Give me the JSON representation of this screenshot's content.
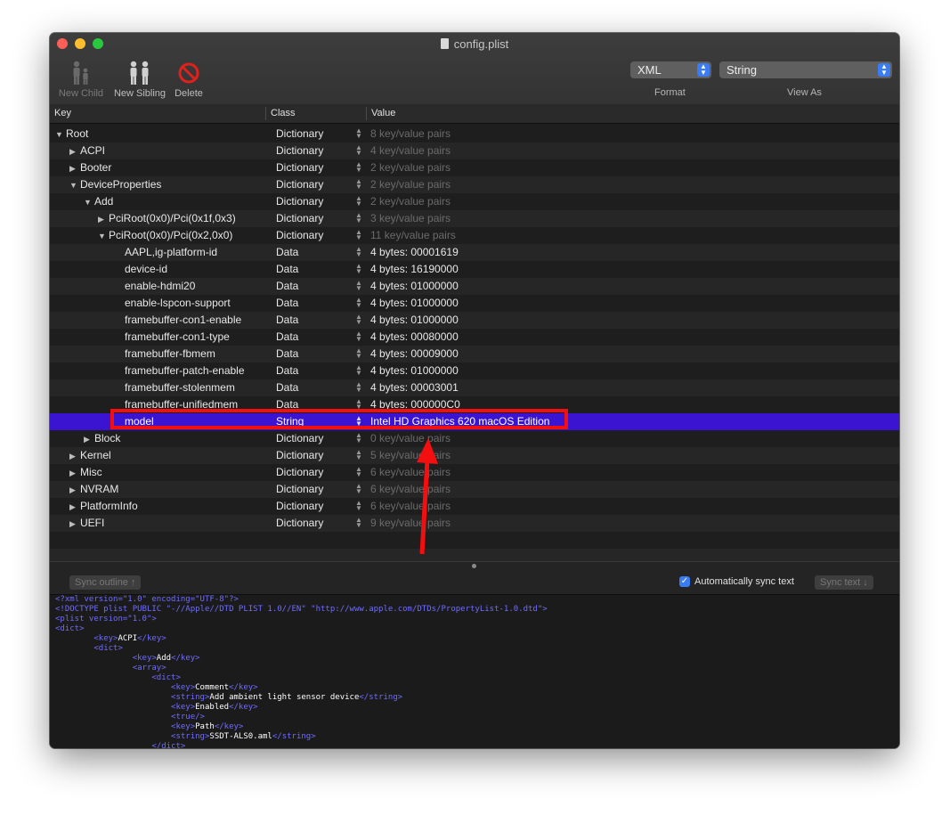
{
  "window": {
    "title": "config.plist"
  },
  "toolbar": {
    "new_child": "New Child",
    "new_sibling": "New Sibling",
    "delete": "Delete",
    "format_value": "XML",
    "format_label": "Format",
    "viewas_value": "String",
    "viewas_label": "View As"
  },
  "columns": {
    "key": "Key",
    "class": "Class",
    "value": "Value"
  },
  "rows": [
    {
      "key": "Root",
      "class": "Dictionary",
      "value": "8 key/value pairs",
      "expander": "open"
    },
    {
      "key": "ACPI",
      "class": "Dictionary",
      "value": "4 key/value pairs",
      "expander": "closed"
    },
    {
      "key": "Booter",
      "class": "Dictionary",
      "value": "2 key/value pairs",
      "expander": "closed"
    },
    {
      "key": "DeviceProperties",
      "class": "Dictionary",
      "value": "2 key/value pairs",
      "expander": "open"
    },
    {
      "key": "Add",
      "class": "Dictionary",
      "value": "2 key/value pairs",
      "expander": "open"
    },
    {
      "key": "PciRoot(0x0)/Pci(0x1f,0x3)",
      "class": "Dictionary",
      "value": "3 key/value pairs",
      "expander": "closed"
    },
    {
      "key": "PciRoot(0x0)/Pci(0x2,0x0)",
      "class": "Dictionary",
      "value": "11 key/value pairs",
      "expander": "open"
    },
    {
      "key": "AAPL,ig-platform-id",
      "class": "Data",
      "value": "4 bytes: 00001619",
      "expander": "none"
    },
    {
      "key": "device-id",
      "class": "Data",
      "value": "4 bytes: 16190000",
      "expander": "none"
    },
    {
      "key": "enable-hdmi20",
      "class": "Data",
      "value": "4 bytes: 01000000",
      "expander": "none"
    },
    {
      "key": "enable-lspcon-support",
      "class": "Data",
      "value": "4 bytes: 01000000",
      "expander": "none"
    },
    {
      "key": "framebuffer-con1-enable",
      "class": "Data",
      "value": "4 bytes: 01000000",
      "expander": "none"
    },
    {
      "key": "framebuffer-con1-type",
      "class": "Data",
      "value": "4 bytes: 00080000",
      "expander": "none"
    },
    {
      "key": "framebuffer-fbmem",
      "class": "Data",
      "value": "4 bytes: 00009000",
      "expander": "none"
    },
    {
      "key": "framebuffer-patch-enable",
      "class": "Data",
      "value": "4 bytes: 01000000",
      "expander": "none"
    },
    {
      "key": "framebuffer-stolenmem",
      "class": "Data",
      "value": "4 bytes: 00003001",
      "expander": "none"
    },
    {
      "key": "framebuffer-unifiedmem",
      "class": "Data",
      "value": "4 bytes: 000000C0",
      "expander": "none"
    },
    {
      "key": "model",
      "class": "String",
      "value": "Intel HD Graphics 620 macOS Edition",
      "expander": "none",
      "selected": true
    },
    {
      "key": "Block",
      "class": "Dictionary",
      "value": "0 key/value pairs",
      "expander": "closed"
    },
    {
      "key": "Kernel",
      "class": "Dictionary",
      "value": "5 key/value pairs",
      "expander": "closed"
    },
    {
      "key": "Misc",
      "class": "Dictionary",
      "value": "6 key/value pairs",
      "expander": "closed"
    },
    {
      "key": "NVRAM",
      "class": "Dictionary",
      "value": "6 key/value pairs",
      "expander": "closed"
    },
    {
      "key": "PlatformInfo",
      "class": "Dictionary",
      "value": "6 key/value pairs",
      "expander": "closed"
    },
    {
      "key": "UEFI",
      "class": "Dictionary",
      "value": "9 key/value pairs",
      "expander": "closed"
    }
  ],
  "sync": {
    "outline_button": "Sync outline ↑",
    "auto_label": "Automatically sync text",
    "auto_checked": true,
    "text_button": "Sync text ↓"
  },
  "xml_lines": [
    {
      "parts": [
        [
          "pi",
          "<?xml version=\"1.0\" encoding=\"UTF-8\"?>"
        ]
      ]
    },
    {
      "parts": [
        [
          "pi",
          "<!DOCTYPE plist PUBLIC \"-//Apple//DTD PLIST 1.0//EN\" \"http://www.apple.com/DTDs/PropertyList-1.0.dtd\">"
        ]
      ]
    },
    {
      "parts": [
        [
          "pi",
          "<plist version=\"1.0\">"
        ]
      ]
    },
    {
      "parts": [
        [
          "tag",
          "<dict>"
        ]
      ]
    },
    {
      "parts": [
        [
          "ws",
          "        "
        ],
        [
          "tag",
          "<key>"
        ],
        [
          "txt",
          "ACPI"
        ],
        [
          "tag",
          "</key>"
        ]
      ]
    },
    {
      "parts": [
        [
          "ws",
          "        "
        ],
        [
          "tag",
          "<dict>"
        ]
      ]
    },
    {
      "parts": [
        [
          "ws",
          "                "
        ],
        [
          "tag",
          "<key>"
        ],
        [
          "txt",
          "Add"
        ],
        [
          "tag",
          "</key>"
        ]
      ]
    },
    {
      "parts": [
        [
          "ws",
          "                "
        ],
        [
          "tag",
          "<array>"
        ]
      ]
    },
    {
      "parts": [
        [
          "ws",
          "                    "
        ],
        [
          "tag",
          "<dict>"
        ]
      ]
    },
    {
      "parts": [
        [
          "ws",
          "                        "
        ],
        [
          "tag",
          "<key>"
        ],
        [
          "txt",
          "Comment"
        ],
        [
          "tag",
          "</key>"
        ]
      ]
    },
    {
      "parts": [
        [
          "ws",
          "                        "
        ],
        [
          "tag",
          "<string>"
        ],
        [
          "txt",
          "Add ambient light sensor device"
        ],
        [
          "tag",
          "</string>"
        ]
      ]
    },
    {
      "parts": [
        [
          "ws",
          "                        "
        ],
        [
          "tag",
          "<key>"
        ],
        [
          "txt",
          "Enabled"
        ],
        [
          "tag",
          "</key>"
        ]
      ]
    },
    {
      "parts": [
        [
          "ws",
          "                        "
        ],
        [
          "tag",
          "<true/>"
        ]
      ]
    },
    {
      "parts": [
        [
          "ws",
          "                        "
        ],
        [
          "tag",
          "<key>"
        ],
        [
          "txt",
          "Path"
        ],
        [
          "tag",
          "</key>"
        ]
      ]
    },
    {
      "parts": [
        [
          "ws",
          "                        "
        ],
        [
          "tag",
          "<string>"
        ],
        [
          "txt",
          "SSDT-ALS0.aml"
        ],
        [
          "tag",
          "</string>"
        ]
      ]
    },
    {
      "parts": [
        [
          "ws",
          "                    "
        ],
        [
          "tag",
          "</dict>"
        ]
      ]
    }
  ]
}
